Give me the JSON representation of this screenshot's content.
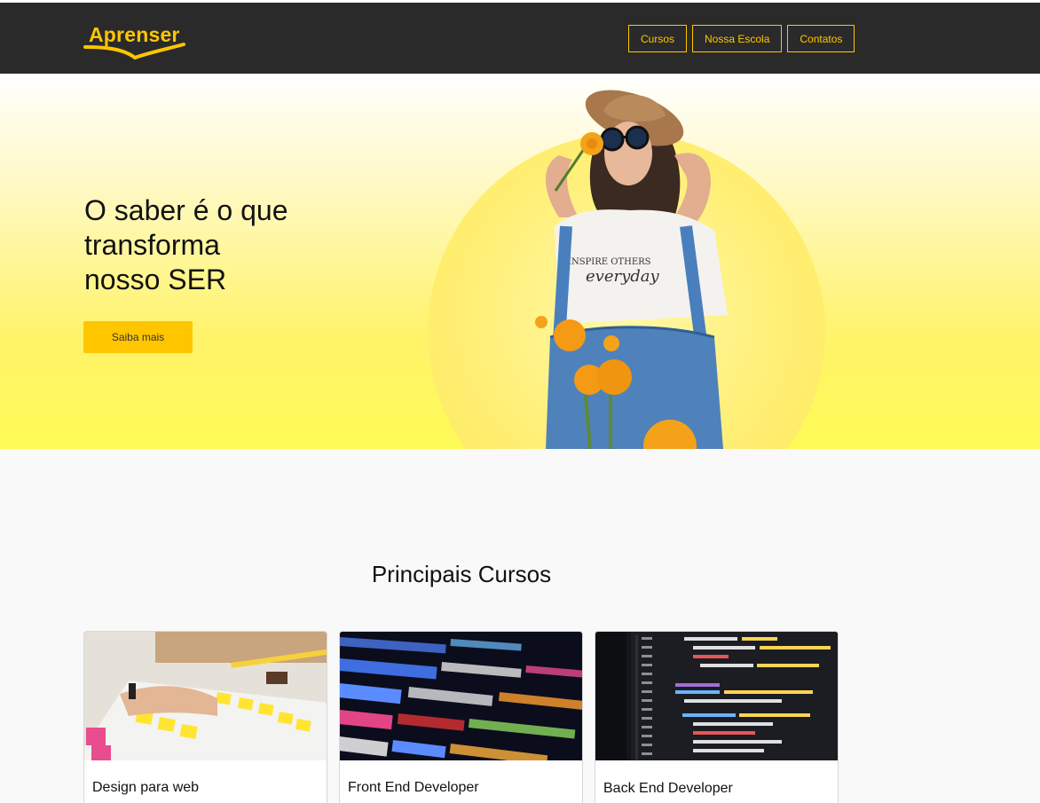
{
  "brand": {
    "logo_text": "Aprenser",
    "accent": "#ffc600",
    "header_bg": "#2a2a2a"
  },
  "nav": {
    "items": [
      "Cursos",
      "Nossa Escola",
      "Contatos"
    ]
  },
  "hero": {
    "title_lines": [
      "O saber é o que",
      "transforma",
      "nosso SER"
    ],
    "cta_label": "Saiba mais",
    "shirt_text_top": "INSPIRE OTHERS",
    "shirt_text_bottom": "everyday"
  },
  "courses": {
    "title": "Principais Cursos",
    "items": [
      {
        "title": "Design para web",
        "image_icon": "sticky-notes-photo"
      },
      {
        "title": "Front End Developer",
        "image_icon": "colorful-code-photo"
      },
      {
        "title": "Back End Developer",
        "image_icon": "code-editor-photo"
      }
    ]
  }
}
